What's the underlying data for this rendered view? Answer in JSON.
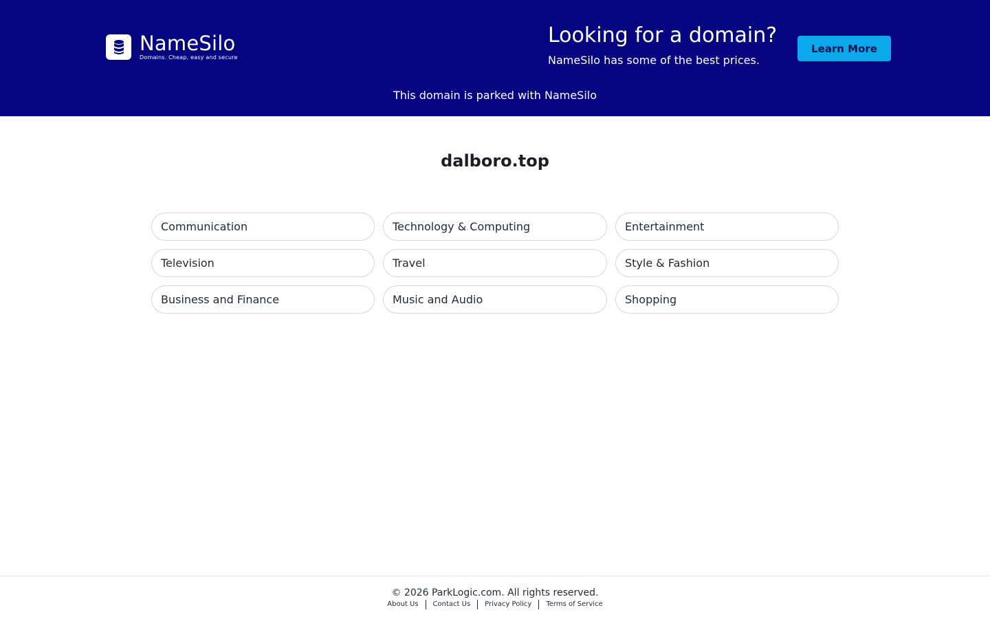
{
  "header": {
    "logo": {
      "name": "NameSilo",
      "tagline": "Domains. Cheap, easy and secure"
    },
    "promo": {
      "title": "Looking for a domain?",
      "subtitle": "NameSilo has some of the best prices."
    },
    "learn_more_label": "Learn More",
    "parked_text": "This domain is parked with NameSilo"
  },
  "main": {
    "domain": "dalboro.top",
    "categories": [
      "Communication",
      "Technology & Computing",
      "Entertainment",
      "Television",
      "Travel",
      "Style & Fashion",
      "Business and Finance",
      "Music and Audio",
      "Shopping"
    ]
  },
  "footer": {
    "copyright": "© 2026 ParkLogic.com. All rights reserved.",
    "links": [
      "About Us",
      "Contact Us",
      "Privacy Policy",
      "Terms of Service"
    ]
  },
  "colors": {
    "header_bg": "#050581",
    "button_bg": "#0ba8ec",
    "chip_border": "#d3d6da"
  },
  "icons": {
    "logo": "database-icon"
  }
}
